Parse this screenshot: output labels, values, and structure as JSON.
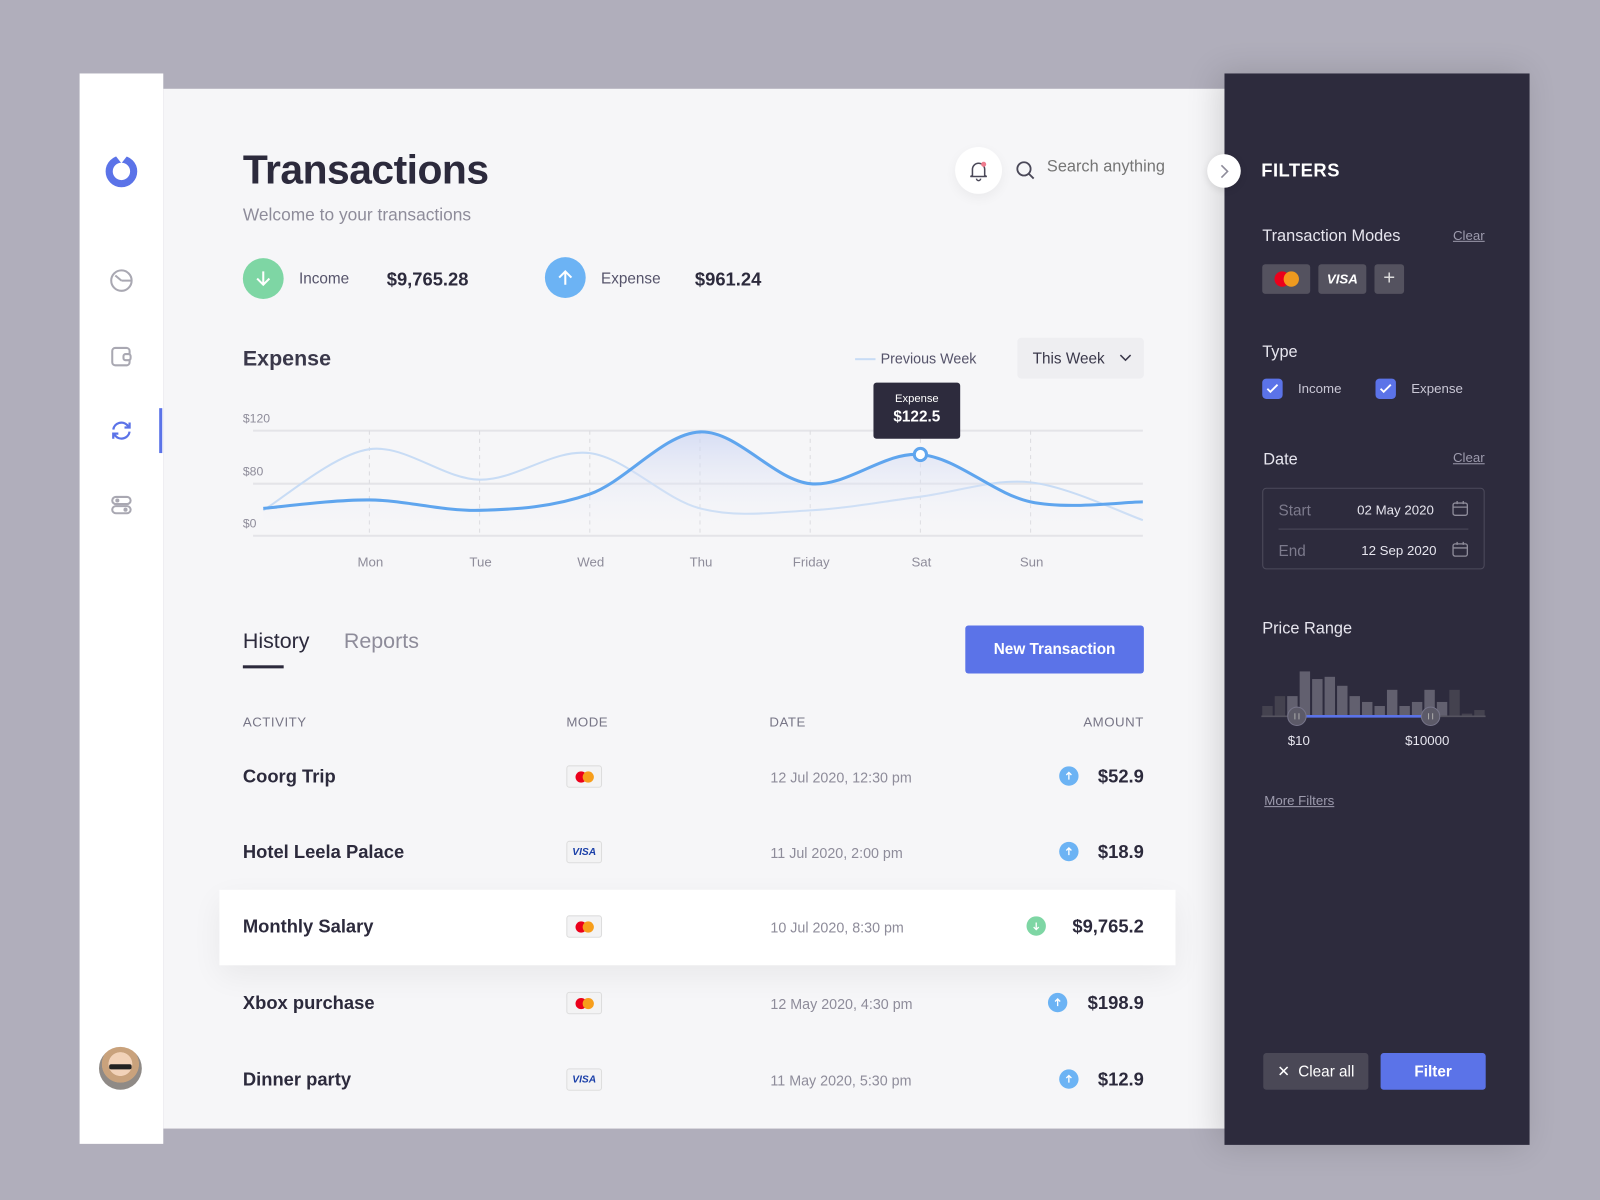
{
  "sidebar": {
    "items": [
      {
        "name": "dashboard",
        "icon": "pie-chart-icon"
      },
      {
        "name": "wallet",
        "icon": "wallet-icon"
      },
      {
        "name": "transactions",
        "icon": "sync-icon",
        "active": true
      },
      {
        "name": "settings",
        "icon": "toggles-icon"
      }
    ],
    "accent": "#5b73e8"
  },
  "header": {
    "title": "Transactions",
    "subtitle": "Welcome to your transactions",
    "search_placeholder": "Search anything"
  },
  "summary": {
    "income_label": "Income",
    "income_value": "$9,765.28",
    "expense_label": "Expense",
    "expense_value": "$961.24"
  },
  "chart": {
    "title": "Expense",
    "legend_label": "Previous Week",
    "period": "This Week",
    "tooltip_label": "Expense",
    "tooltip_value": "$122.5"
  },
  "chart_data": {
    "type": "line",
    "title": "Expense",
    "categories": [
      "Mon",
      "Tue",
      "Wed",
      "Thu",
      "Friday",
      "Sat",
      "Sun"
    ],
    "y_ticks": [
      "$120",
      "$80",
      "$0"
    ],
    "ylim": [
      0,
      120
    ],
    "grid": true,
    "series": [
      {
        "name": "This Week",
        "values": [
          55,
          39,
          64,
          119,
          80,
          102,
          52
        ],
        "color": "#5fa5ee"
      },
      {
        "name": "Previous Week",
        "values": [
          106,
          83,
          103,
          42,
          39,
          60,
          81
        ],
        "color": "#c8dcf5"
      }
    ],
    "highlight": {
      "category": "Sat",
      "value": 122.5
    }
  },
  "tabs": [
    {
      "label": "History",
      "active": true
    },
    {
      "label": "Reports"
    }
  ],
  "new_transaction_label": "New Transaction",
  "table": {
    "headers": [
      "ACTIVITY",
      "MODE",
      "DATE",
      "AMOUNT"
    ],
    "rows": [
      {
        "activity": "Coorg Trip",
        "mode": "mastercard",
        "date": "12 Jul 2020, 12:30 pm",
        "type": "expense",
        "amount": "$52.9"
      },
      {
        "activity": "Hotel Leela Palace",
        "mode": "visa",
        "date": "11 Jul 2020, 2:00 pm",
        "type": "expense",
        "amount": "$18.9"
      },
      {
        "activity": "Monthly Salary",
        "mode": "mastercard",
        "date": "10 Jul 2020, 8:30 pm",
        "type": "income",
        "amount": "$9,765.2"
      },
      {
        "activity": "Xbox purchase",
        "mode": "mastercard",
        "date": "12 May 2020, 4:30 pm",
        "type": "expense",
        "amount": "$198.9"
      },
      {
        "activity": "Dinner party",
        "mode": "visa",
        "date": "11 May 2020, 5:30 pm",
        "type": "expense",
        "amount": "$12.9"
      }
    ]
  },
  "filters": {
    "title": "FILTERS",
    "modes_label": "Transaction Modes",
    "clear": "Clear",
    "visa": "VISA",
    "add": "+",
    "type_label": "Type",
    "type_income": "Income",
    "type_expense": "Expense",
    "income_checked": true,
    "expense_checked": true,
    "date_label": "Date",
    "start_label": "Start",
    "start_value": "02 May 2020",
    "end_label": "End",
    "end_value": "12 Sep 2020",
    "price_label": "Price Range",
    "price_min": "$10",
    "price_max": "$10000",
    "histogram": [
      23,
      45,
      45,
      100,
      83,
      88,
      68,
      45,
      32,
      23,
      59,
      23,
      32,
      59,
      32,
      59,
      6,
      14
    ],
    "more_filters": "More Filters",
    "clear_all": "Clear all",
    "filter_button": "Filter"
  }
}
